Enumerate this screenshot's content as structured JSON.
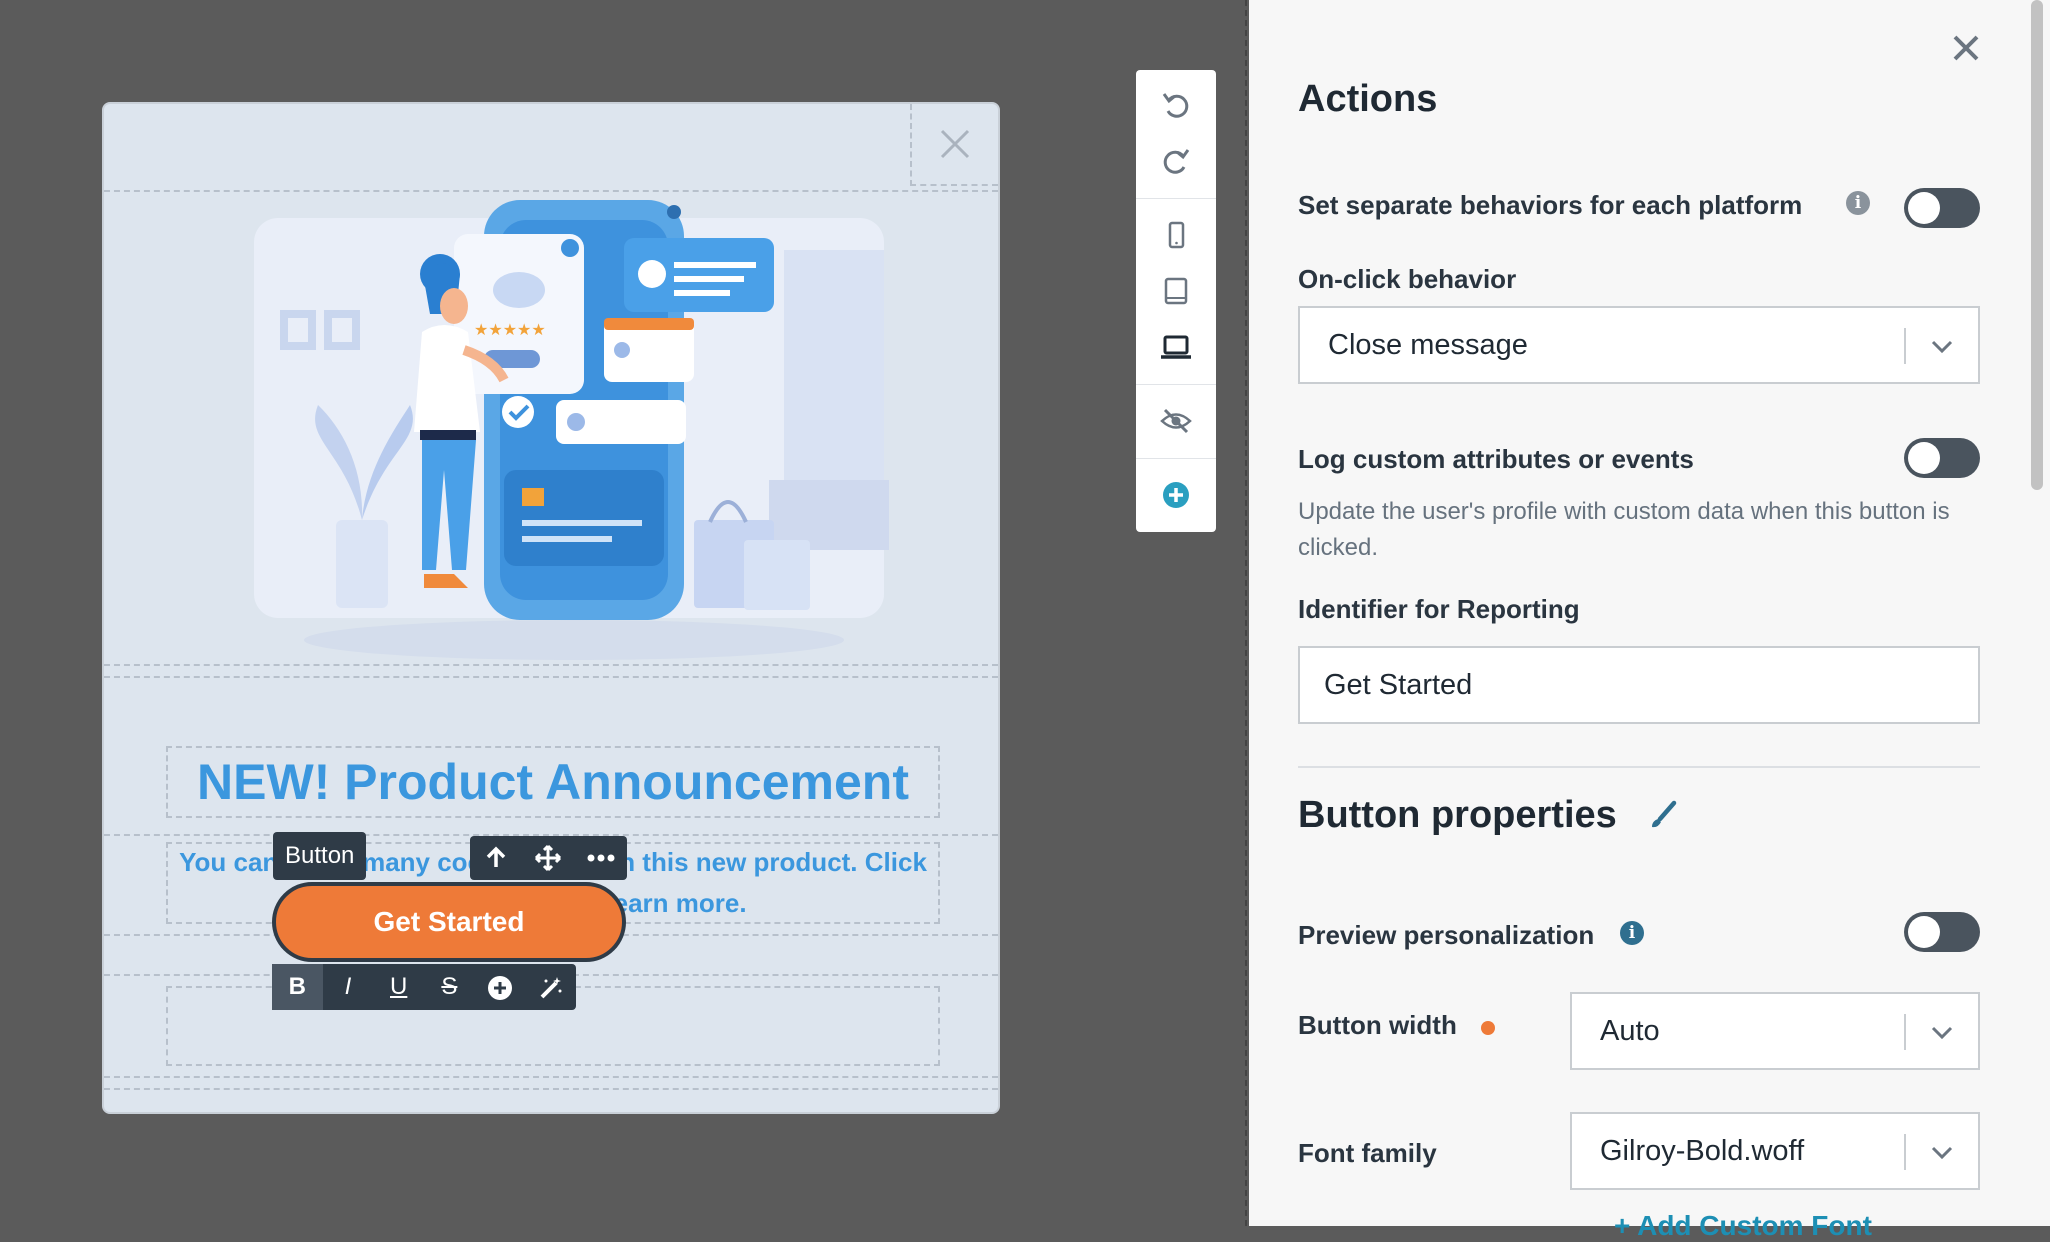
{
  "modal": {
    "headline": "NEW! Product Announcement",
    "body_line1": "You can do so many cool things with this new product. Click",
    "body_line2": "the button below to learn more.",
    "button_tag": "Button",
    "cta_label": "Get Started",
    "format_buttons": [
      "B",
      "I",
      "U",
      "S"
    ]
  },
  "panel": {
    "title": "Actions",
    "separate_behaviors_label": "Set separate behaviors for each platform",
    "onclick_label": "On-click behavior",
    "onclick_value": "Close message",
    "log_label": "Log custom attributes or events",
    "log_helper": "Update the user's profile with custom data when this button is clicked.",
    "identifier_label": "Identifier for Reporting",
    "identifier_value": "Get Started",
    "props_title": "Button properties",
    "preview_label": "Preview personalization",
    "width_label": "Button width",
    "width_value": "Auto",
    "font_label": "Font family",
    "font_value": "Gilroy-Bold.woff",
    "add_font": "+ Add Custom Font"
  },
  "colors": {
    "accent_blue": "#3b97de",
    "cta_orange": "#ee7a38",
    "toggle_off": "#4a545e",
    "link_teal": "#1d8fb4"
  }
}
